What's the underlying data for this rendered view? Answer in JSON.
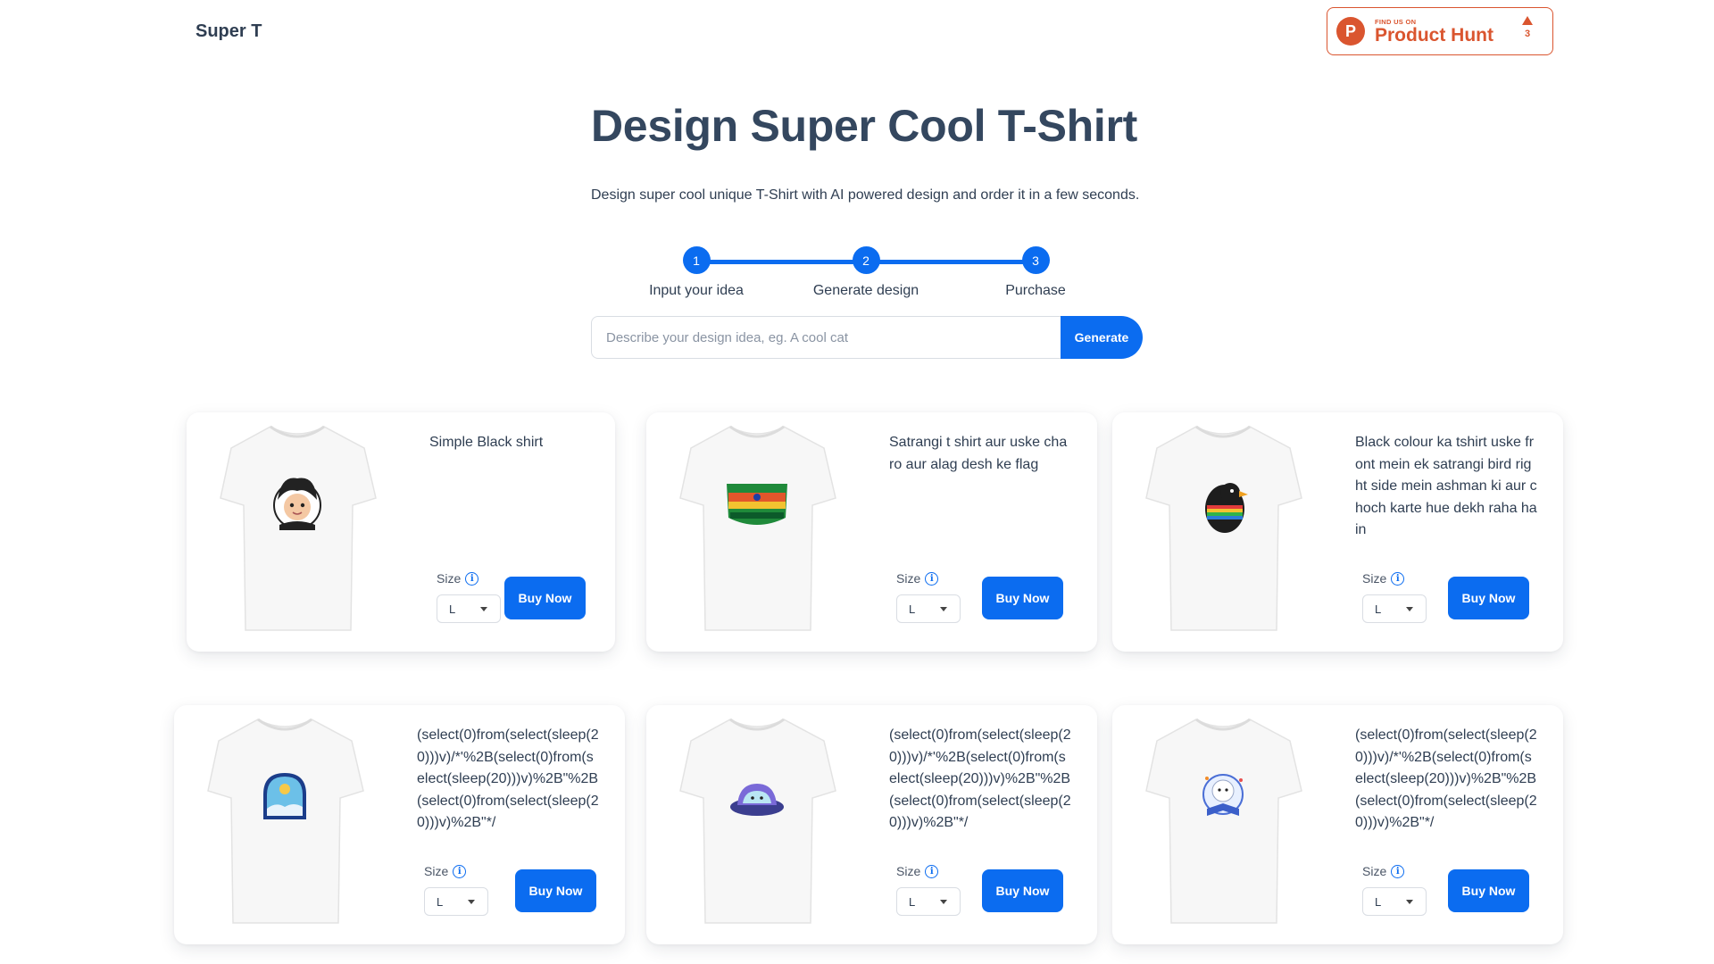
{
  "header": {
    "brand": "Super T",
    "product_hunt": {
      "logo_letter": "P",
      "small_text": "FIND US ON",
      "big_text": "Product Hunt",
      "votes": "3",
      "color": "#da552f"
    }
  },
  "hero": {
    "title": "Design Super Cool T-Shirt",
    "subtitle": "Design super cool unique T-Shirt with AI powered design and order it in a few seconds."
  },
  "steps": [
    {
      "number": "1",
      "label": "Input your idea"
    },
    {
      "number": "2",
      "label": "Generate design"
    },
    {
      "number": "3",
      "label": "Purchase"
    }
  ],
  "prompt": {
    "placeholder": "Describe your design idea, eg. A cool cat",
    "value": "",
    "button_label": "Generate"
  },
  "accent_color": "#0b6cf0",
  "cards": [
    {
      "description": "Simple Black shirt",
      "size_label": "Size",
      "size": "L",
      "buy_label": "Buy Now",
      "design": "cartoon-boy-sticker"
    },
    {
      "description": "Satrangi t shirt aur uske charo aur alag desh ke flag",
      "size_label": "Size",
      "size": "L",
      "buy_label": "Buy Now",
      "design": "colorful-flag-banner"
    },
    {
      "description": "Black colour ka tshirt uske front mein ek satrangi bird right side mein ashman ki aur choch karte hue dekh raha hain",
      "size_label": "Size",
      "size": "L",
      "buy_label": "Buy Now",
      "design": "rainbow-bird"
    },
    {
      "description": "(select(0)from(select(sleep(20)))v)/*'%2B(select(0)from(select(sleep(20)))v)%2B\"%2B(select(0)from(select(sleep(20)))v)%2B\"*/",
      "size_label": "Size",
      "size": "L",
      "buy_label": "Buy Now",
      "design": "arch-landscape"
    },
    {
      "description": "(select(0)from(select(sleep(20)))v)/*'%2B(select(0)from(select(sleep(20)))v)%2B\"%2B(select(0)from(select(sleep(20)))v)%2B\"*/",
      "size_label": "Size",
      "size": "L",
      "buy_label": "Buy Now",
      "design": "ufo-creature"
    },
    {
      "description": "(select(0)from(select(sleep(20)))v)/*'%2B(select(0)from(select(sleep(20)))v)%2B\"%2B(select(0)from(select(sleep(20)))v)%2B\"*/",
      "size_label": "Size",
      "size": "L",
      "buy_label": "Buy Now",
      "design": "seal-reading-book"
    }
  ]
}
